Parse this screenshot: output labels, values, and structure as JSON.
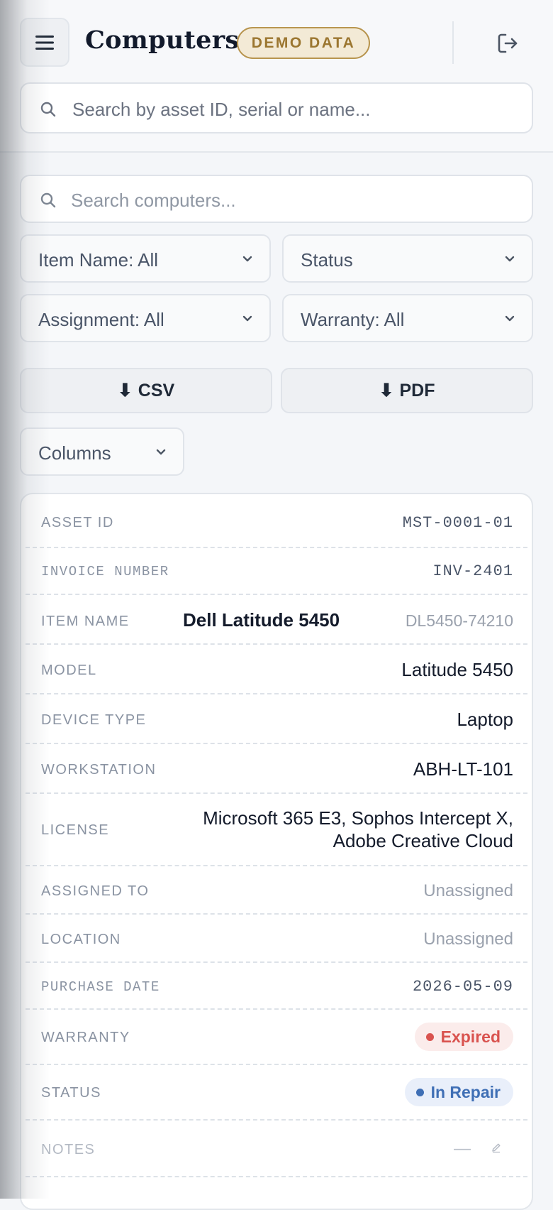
{
  "header": {
    "title": "Computers",
    "badge": "DEMO DATA",
    "global_search_placeholder": "Search by asset ID, serial or name..."
  },
  "filters": {
    "search_placeholder": "Search computers...",
    "item_name": "Item Name: All",
    "status": "Status",
    "assignment": "Assignment: All",
    "warranty": "Warranty: All"
  },
  "actions": {
    "csv_icon": "⬇",
    "csv_label": "CSV",
    "pdf_icon": "⬇",
    "pdf_label": "PDF",
    "columns_label": "Columns"
  },
  "record": {
    "asset_id": {
      "label": "ASSET ID",
      "value": "MST-0001-01"
    },
    "invoice_number": {
      "label": "INVOICE NUMBER",
      "value": "INV-2401"
    },
    "item_name": {
      "label": "ITEM NAME",
      "value": "Dell Latitude 5450",
      "serial": "DL5450-74210"
    },
    "model": {
      "label": "MODEL",
      "value": "Latitude 5450"
    },
    "device_type": {
      "label": "DEVICE TYPE",
      "value": "Laptop"
    },
    "workstation": {
      "label": "WORKSTATION",
      "value": "ABH-LT-101"
    },
    "license": {
      "label": "LICENSE",
      "line1": "Microsoft 365 E3, Sophos Intercept X,",
      "line2": "Adobe Creative Cloud"
    },
    "assigned_to": {
      "label": "ASSIGNED TO",
      "value": "Unassigned"
    },
    "location": {
      "label": "LOCATION",
      "value": "Unassigned"
    },
    "purchase_date": {
      "label": "PURCHASE DATE",
      "value": "2026-05-09"
    },
    "warranty": {
      "label": "WARRANTY",
      "value": "Expired"
    },
    "status": {
      "label": "STATUS",
      "value": "In Repair"
    },
    "notes": {
      "label": "NOTES",
      "value": "—"
    }
  },
  "colors": {
    "accent_gold": "#b8954f",
    "expired": "#d9534f",
    "in_repair": "#3f6fb5"
  },
  "icons": [
    "menu-icon",
    "logout-icon",
    "search-icon",
    "chevron-down-icon",
    "download-icon",
    "edit-icon"
  ]
}
